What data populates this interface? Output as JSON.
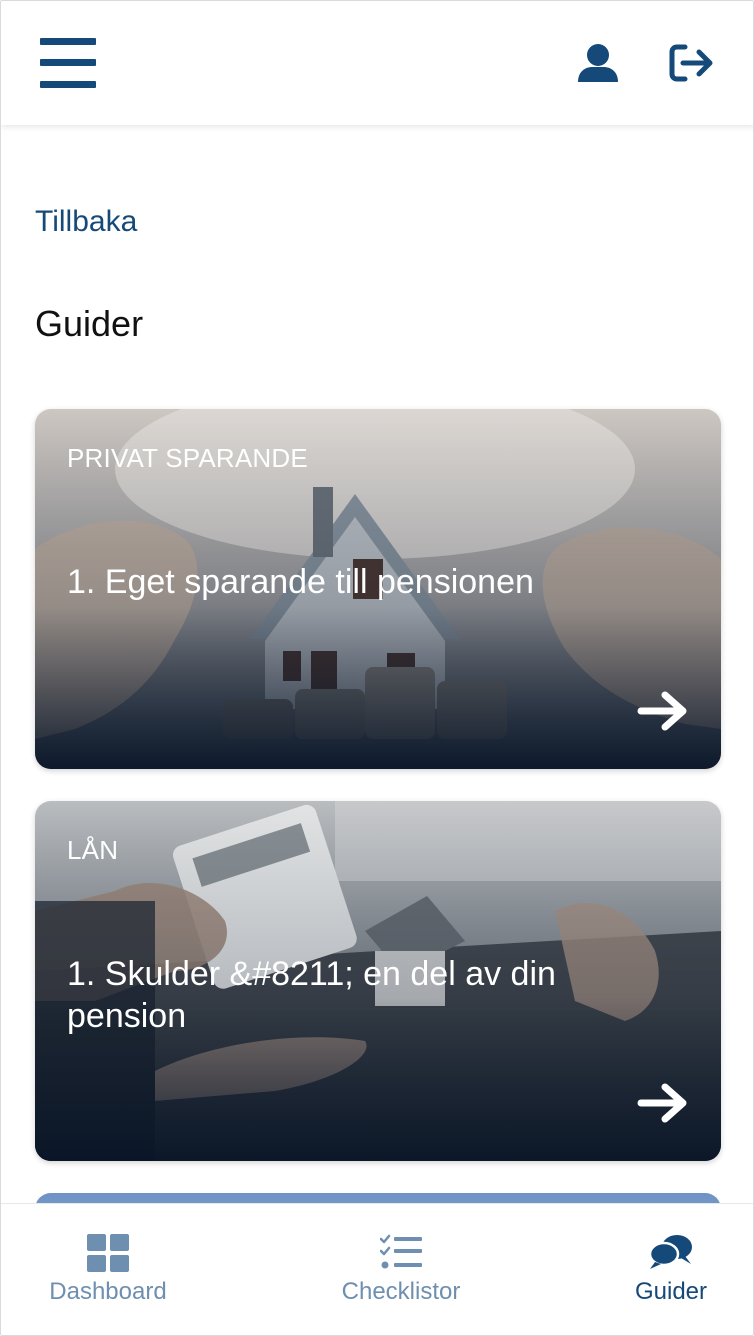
{
  "header": {
    "menu_icon": "hamburger-menu-icon",
    "profile_icon": "user-icon",
    "logout_icon": "sign-out-icon"
  },
  "nav": {
    "back_label": "Tillbaka"
  },
  "page": {
    "title": "Guider"
  },
  "cards": [
    {
      "category": "PRIVAT SPARANDE",
      "title": "1. Eget sparande till pensionen",
      "icon": "arrow-right-icon"
    },
    {
      "category": "LÅN",
      "title": "1. Skulder &#8211; en del av din pension",
      "icon": "arrow-right-icon"
    }
  ],
  "tabbar": {
    "tabs": [
      {
        "label": "Dashboard",
        "icon": "dashboard-grid-icon",
        "active": false
      },
      {
        "label": "Checklistor",
        "icon": "checklist-icon",
        "active": false
      },
      {
        "label": "Guider",
        "icon": "chat-bubbles-icon",
        "active": true
      }
    ]
  },
  "colors": {
    "brand": "#14497a",
    "tab_inactive": "#6f8fb0"
  }
}
